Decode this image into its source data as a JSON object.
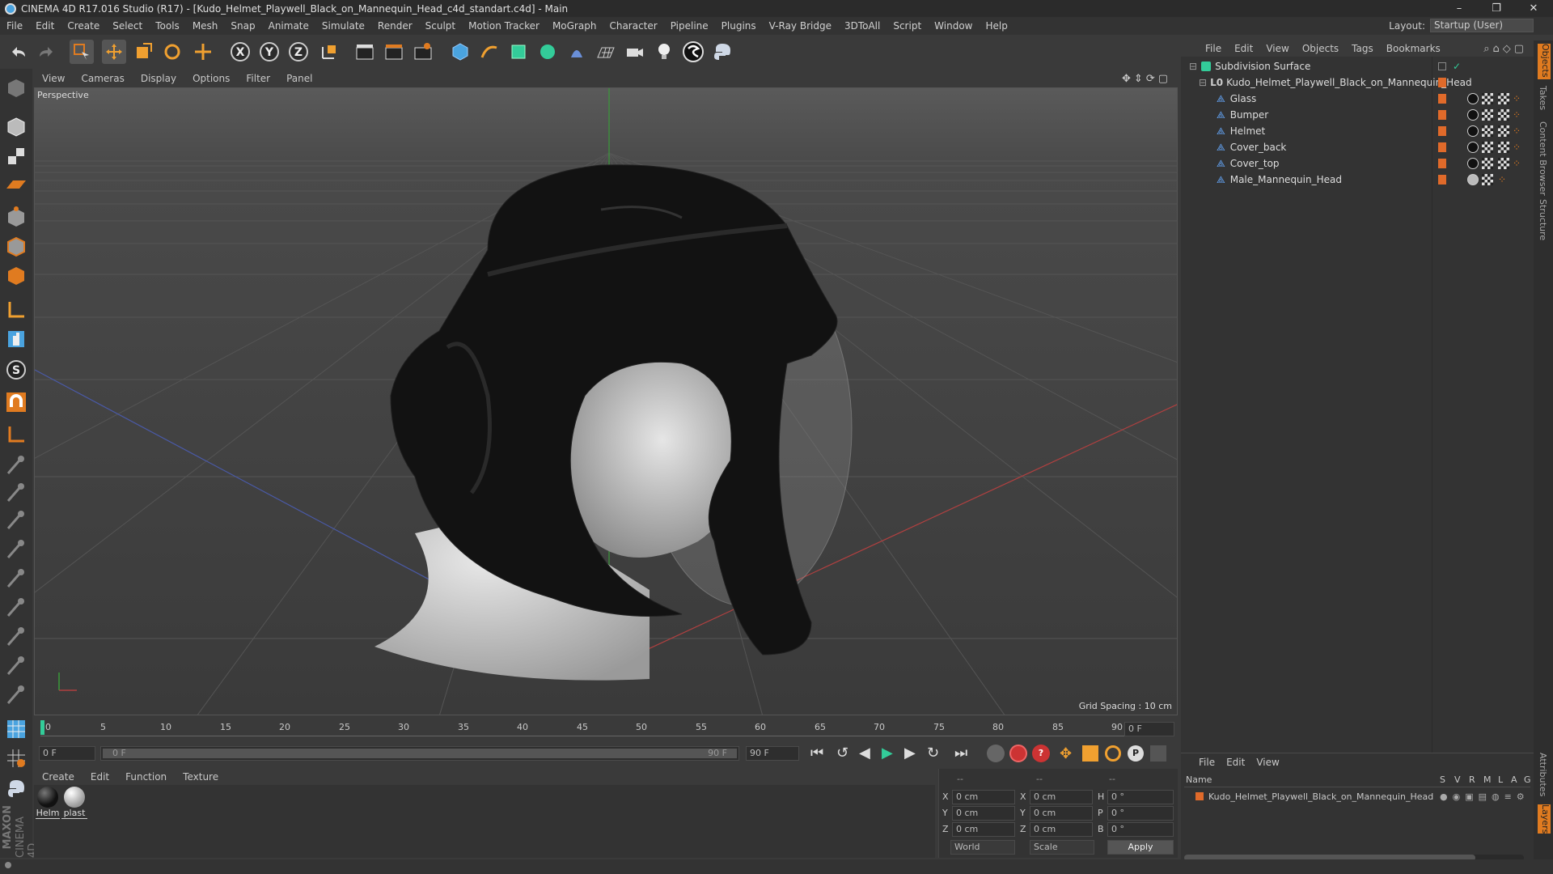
{
  "window": {
    "title": "CINEMA 4D R17.016 Studio (R17) - [Kudo_Helmet_Playwell_Black_on_Mannequin_Head_c4d_standart.c4d] - Main",
    "controls": [
      "–",
      "❐",
      "✕"
    ]
  },
  "menubar": {
    "items": [
      "File",
      "Edit",
      "Create",
      "Select",
      "Tools",
      "Mesh",
      "Snap",
      "Animate",
      "Simulate",
      "Render",
      "Sculpt",
      "Motion Tracker",
      "MoGraph",
      "Character",
      "Pipeline",
      "Plugins",
      "V-Ray Bridge",
      "3DToAll",
      "Script",
      "Window",
      "Help"
    ],
    "layout_label": "Layout:",
    "layout_value": "Startup (User)"
  },
  "viewport": {
    "menu": [
      "View",
      "Cameras",
      "Display",
      "Options",
      "Filter",
      "Panel"
    ],
    "camera_label": "Perspective",
    "grid_spacing": "Grid Spacing : 10 cm"
  },
  "timeline": {
    "ticks": [
      "0",
      "5",
      "10",
      "15",
      "20",
      "25",
      "30",
      "35",
      "40",
      "45",
      "50",
      "55",
      "60",
      "65",
      "70",
      "75",
      "80",
      "85",
      "90"
    ],
    "current_frame": "0 F",
    "start_field": "0 F",
    "range_start": "0 F",
    "range_end": "90 F",
    "end_field": "90 F"
  },
  "materials": {
    "menu": [
      "Create",
      "Edit",
      "Function",
      "Texture"
    ],
    "items": [
      {
        "label": "Helm",
        "color": "#111111"
      },
      {
        "label": "plast",
        "color": "#cfcfcf"
      }
    ]
  },
  "coords": {
    "header": [
      "--",
      "--",
      "--"
    ],
    "rows": [
      {
        "a": "X",
        "av": "0 cm",
        "b": "X",
        "bv": "0 cm",
        "c": "H",
        "cv": "0 °"
      },
      {
        "a": "Y",
        "av": "0 cm",
        "b": "Y",
        "bv": "0 cm",
        "c": "P",
        "cv": "0 °"
      },
      {
        "a": "Z",
        "av": "0 cm",
        "b": "Z",
        "bv": "0 cm",
        "c": "B",
        "cv": "0 °"
      }
    ],
    "mode1": "World",
    "mode2": "Scale",
    "apply": "Apply"
  },
  "objects": {
    "menu": [
      "File",
      "Edit",
      "View",
      "Objects",
      "Tags",
      "Bookmarks"
    ],
    "tree": [
      {
        "name": "Subdivision Surface",
        "indent": 0,
        "icon": "subdivision-icon"
      },
      {
        "name": "Kudo_Helmet_Playwell_Black_on_Mannequin_Head",
        "indent": 1,
        "icon": "null-icon"
      },
      {
        "name": "Glass",
        "indent": 2,
        "icon": "polygon-icon"
      },
      {
        "name": "Bumper",
        "indent": 2,
        "icon": "polygon-icon"
      },
      {
        "name": "Helmet",
        "indent": 2,
        "icon": "polygon-icon"
      },
      {
        "name": "Cover_back",
        "indent": 2,
        "icon": "polygon-icon"
      },
      {
        "name": "Cover_top",
        "indent": 2,
        "icon": "polygon-icon"
      },
      {
        "name": "Male_Mannequin_Head",
        "indent": 2,
        "icon": "polygon-icon"
      }
    ]
  },
  "layers": {
    "menu": [
      "File",
      "Edit",
      "View"
    ],
    "header_name": "Name",
    "header_cols": [
      "S",
      "V",
      "R",
      "M",
      "L",
      "A",
      "G"
    ],
    "rows": [
      "Kudo_Helmet_Playwell_Black_on_Mannequin_Head"
    ]
  },
  "side_tabs": [
    "Objects",
    "Takes",
    "Content Browser",
    "Structure",
    "Attributes",
    "Layers"
  ],
  "brand": {
    "line1": "MAXON",
    "line2": "CINEMA 4D"
  },
  "colors": {
    "accent": "#e07b20",
    "object_tag": "#e06a2a",
    "selection": "#555555"
  }
}
